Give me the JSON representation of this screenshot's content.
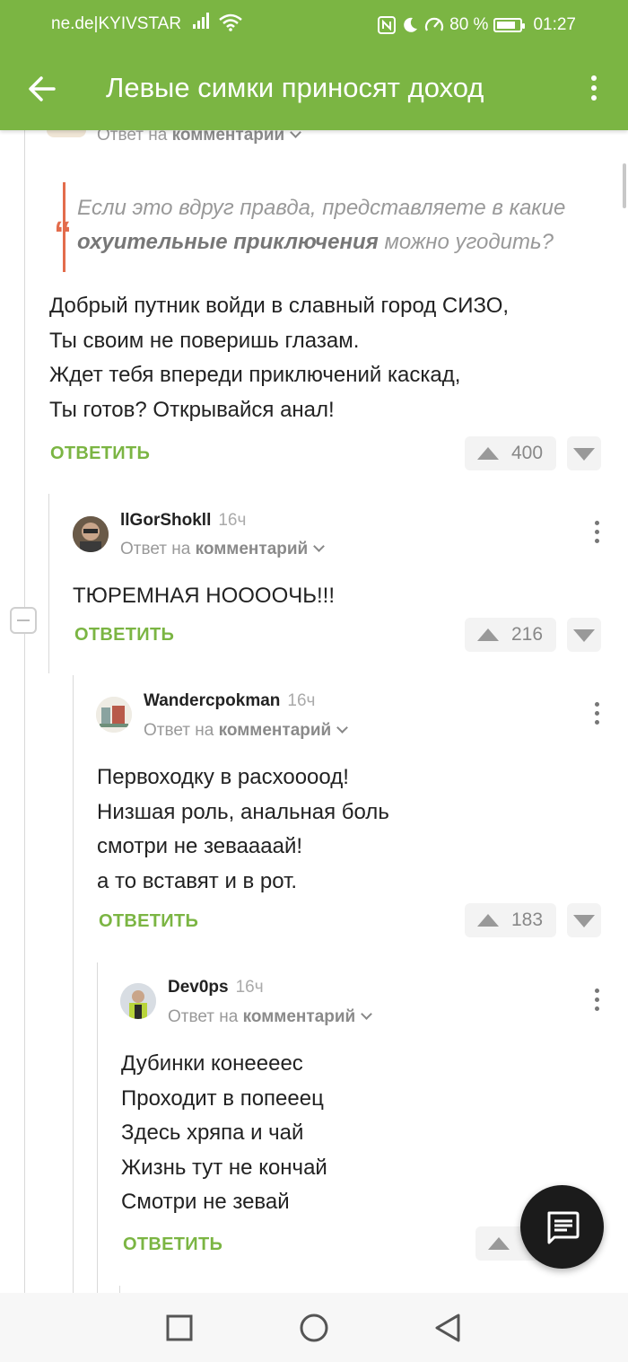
{
  "status_bar": {
    "carrier": "ne.de|KYIVSTAR",
    "battery": "80 %",
    "time": "01:27"
  },
  "header": {
    "title": "Левые симки приносят доход"
  },
  "top_comment_partial": {
    "reply_prefix": "Ответ на",
    "reply_target": "комментарии"
  },
  "main_comment": {
    "quote": {
      "part1": "Если это вдруг правда, представляете в какие ",
      "bold": "охуительные приключения",
      "part2": " можно угодить?"
    },
    "body": "Добрый путник войди в славный город СИЗО,\nТы своим не поверишь глазам.\nЖдет тебя впереди приключений каскад,\nТы готов? Открывайся анал!",
    "reply_label": "ОТВЕТИТЬ",
    "votes": "400"
  },
  "comments": [
    {
      "author": "llGorShokll",
      "time": "16ч",
      "reply_prefix": "Ответ на",
      "reply_target": "комментарий",
      "body": "ТЮРЕМНАЯ НОООOЧЬ!!!",
      "reply_label": "ОТВЕТИТЬ",
      "votes": "216"
    },
    {
      "author": "Wandercpokman",
      "time": "16ч",
      "reply_prefix": "Ответ на",
      "reply_target": "комментарий",
      "body": "Первоходку в расхоооод!\nНизшая роль, анальная боль\nсмотри не зеваааай!\nа то вставят и в рот.",
      "reply_label": "ОТВЕТИТЬ",
      "votes": "183"
    },
    {
      "author": "Dev0ps",
      "time": "16ч",
      "reply_prefix": "Ответ на",
      "reply_target": "комментарий",
      "body": "Дубинки конееееc\nПроходит в попееец\nЗдесь хряпа и чай\nЖизнь тут не кончай\nСмотри не зевай",
      "reply_label": "ОТВЕТИТЬ"
    }
  ],
  "colors": {
    "brand_green": "#7bb543",
    "quote_accent": "#e36c4c",
    "fab": "#1b1b1b"
  }
}
